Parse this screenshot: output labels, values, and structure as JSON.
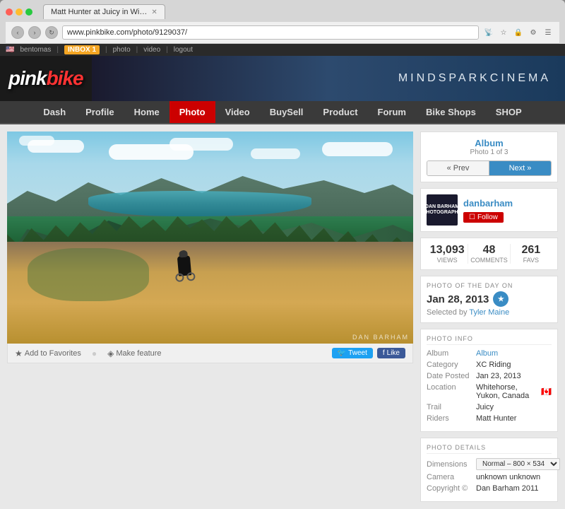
{
  "browser": {
    "tab_title": "Matt Hunter at Juicy in Wi…",
    "url": "www.pinkbike.com/photo/9129037/",
    "nav_buttons": {
      "back": "‹",
      "forward": "›",
      "refresh": "↻",
      "home": "⌂"
    }
  },
  "utility_bar": {
    "flag": "🇺🇸",
    "username": "bentomas",
    "inbox_label": "INBOX",
    "inbox_count": "1",
    "links": [
      "photo",
      "video",
      "logout"
    ]
  },
  "header": {
    "logo_prefix": "pink",
    "logo_suffix": "bike",
    "banner_text_1": "MINDSPARK",
    "banner_text_2": "CINEMA"
  },
  "nav": {
    "items": [
      "Dash",
      "Profile",
      "Home",
      "Photo",
      "Video",
      "BuySell",
      "Product",
      "Forum",
      "Bike Shops",
      "SHOP"
    ],
    "active": "Photo"
  },
  "photo": {
    "credit": "DAN BARHAM",
    "actions": {
      "add_to_favorites": "Add to Favorites",
      "make_feature": "Make feature"
    },
    "social": {
      "tweet": "Tweet",
      "like": "Like"
    }
  },
  "album": {
    "title": "Album",
    "subtitle": "Photo 1 of 3",
    "prev_label": "« Prev",
    "next_label": "Next »"
  },
  "user": {
    "name": "danbarham",
    "avatar_line1": "DAN BARHAM",
    "avatar_line2": "PHOTOGRAPHY",
    "follow_label": "Follow"
  },
  "stats": {
    "views": "13,093",
    "views_label": "VIEWS",
    "comments": "48",
    "comments_label": "COMMENTS",
    "favs": "261",
    "favs_label": "FAVS"
  },
  "photo_of_day": {
    "section_label": "PHOTO OF THE DAY ON",
    "date": "Jan 28, 2013",
    "selected_by": "Selected by",
    "selector_name": "Tyler Maine"
  },
  "photo_info": {
    "section_title": "PHOTO INFO",
    "category_key": "Category",
    "category_val": "XC Riding",
    "album_key": "Album",
    "album_val": "Album",
    "date_key": "Date Posted",
    "date_val": "Jan 23, 2013",
    "location_key": "Location",
    "location_val": "Whitehorse, Yukon, Canada",
    "trail_key": "Trail",
    "trail_val": "Juicy",
    "riders_key": "Riders",
    "riders_val": "Matt Hunter"
  },
  "photo_details": {
    "section_title": "PHOTO DETAILS",
    "dimensions_key": "Dimensions",
    "dimensions_val": "Normal – 800 × 534",
    "camera_key": "Camera",
    "camera_val": "unknown unknown",
    "copyright_key": "Copyright ©",
    "copyright_val": "Dan Barham 2011"
  }
}
